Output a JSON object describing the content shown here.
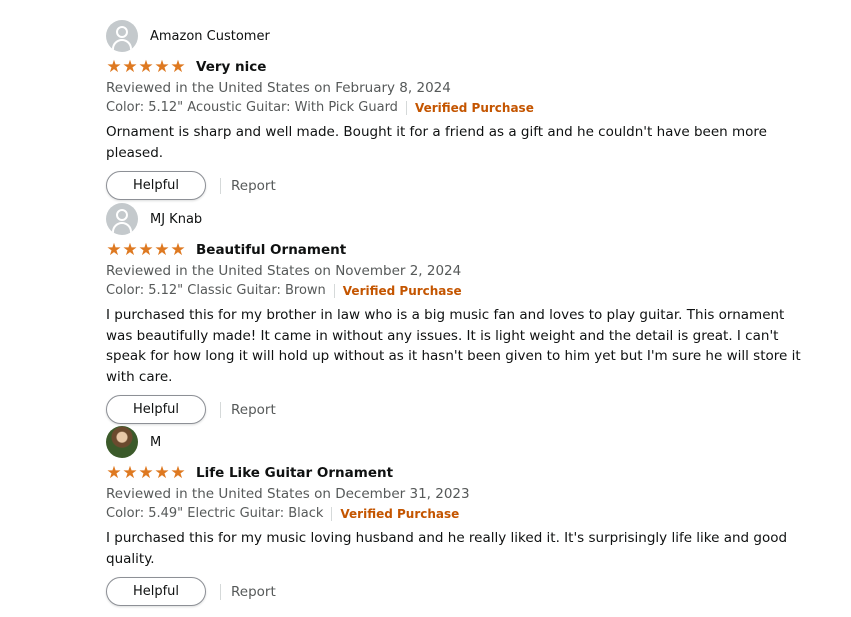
{
  "reviews": [
    {
      "author": "Amazon Customer",
      "avatar": "default-avatar-icon",
      "rating": 5,
      "title": "Very nice",
      "reviewed": "Reviewed in the United States on February 8, 2024",
      "variant": "Color: 5.12\" Acoustic Guitar: With Pick Guard",
      "verified": "Verified Purchase",
      "body": "Ornament is sharp and well made. Bought it for a friend as a gift and he couldn't have been more pleased.",
      "helpful_label": "Helpful",
      "report_label": "Report"
    },
    {
      "author": "MJ Knab",
      "avatar": "default-avatar-icon",
      "rating": 5,
      "title": "Beautiful Ornament",
      "reviewed": "Reviewed in the United States on November 2, 2024",
      "variant": "Color: 5.12\" Classic Guitar: Brown",
      "verified": "Verified Purchase",
      "body": "I purchased this for my brother in law who is a big music fan and loves to play guitar. This ornament was beautifully made! It came in without any issues. It is light weight and the detail is great. I can't speak for how long it will hold up without as it hasn't been given to him yet but I'm sure he will store it with care.",
      "helpful_label": "Helpful",
      "report_label": "Report"
    },
    {
      "author": "M",
      "avatar": "photo-avatar",
      "rating": 5,
      "title": "Life Like Guitar Ornament",
      "reviewed": "Reviewed in the United States on December 31, 2023",
      "variant": "Color: 5.49\" Electric Guitar: Black",
      "verified": "Verified Purchase",
      "body": "I purchased this for my music loving husband and he really liked it. It's surprisingly life like and good quality.",
      "helpful_label": "Helpful",
      "report_label": "Report"
    }
  ],
  "colors": {
    "star": "#de7921",
    "verified": "#c45500",
    "meta": "#565959"
  }
}
